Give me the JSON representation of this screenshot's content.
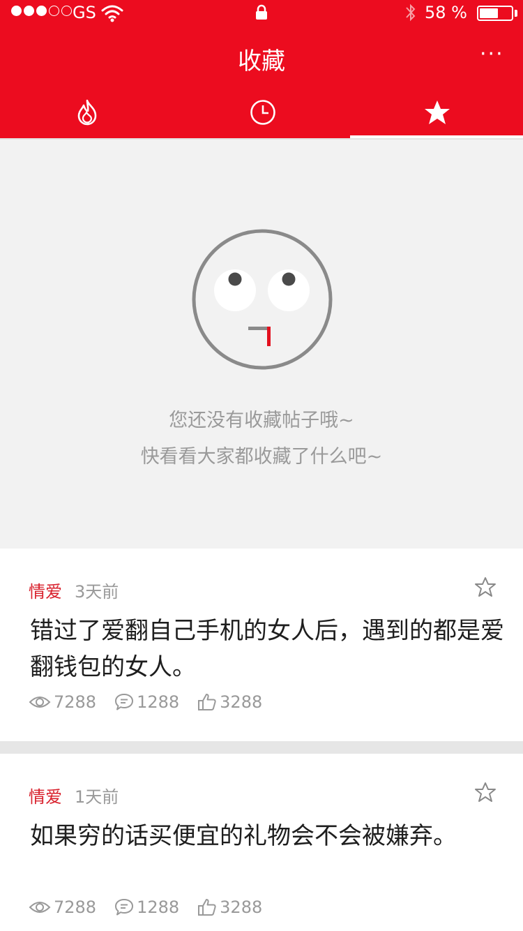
{
  "status_bar": {
    "carrier": "GS",
    "battery_percent": "58 %",
    "battery_level": 0.58,
    "signal_bars_filled": 3,
    "signal_bars_total": 5
  },
  "header": {
    "title": "收藏",
    "more_label": "···"
  },
  "tabs": [
    {
      "icon": "flame-icon"
    },
    {
      "icon": "clock-icon"
    },
    {
      "icon": "star-icon",
      "active": true
    }
  ],
  "empty_state": {
    "line1": "您还没有收藏帖子哦~",
    "line2": "快看看大家都收藏了什么吧~"
  },
  "posts": [
    {
      "category": "情爱",
      "time": "3天前",
      "title": "错过了爱翻自己手机的女人后，遇到的都是爱翻钱包的女人。",
      "views": "7288",
      "comments": "1288",
      "likes": "3288"
    },
    {
      "category": "情爱",
      "time": "1天前",
      "title": "如果穷的话买便宜的礼物会不会被嫌弃。",
      "views": "7288",
      "comments": "1288",
      "likes": "3288"
    }
  ],
  "colors": {
    "brand_red": "#ec0c1f",
    "category_red": "#d81e2a",
    "muted_text": "#999999"
  }
}
